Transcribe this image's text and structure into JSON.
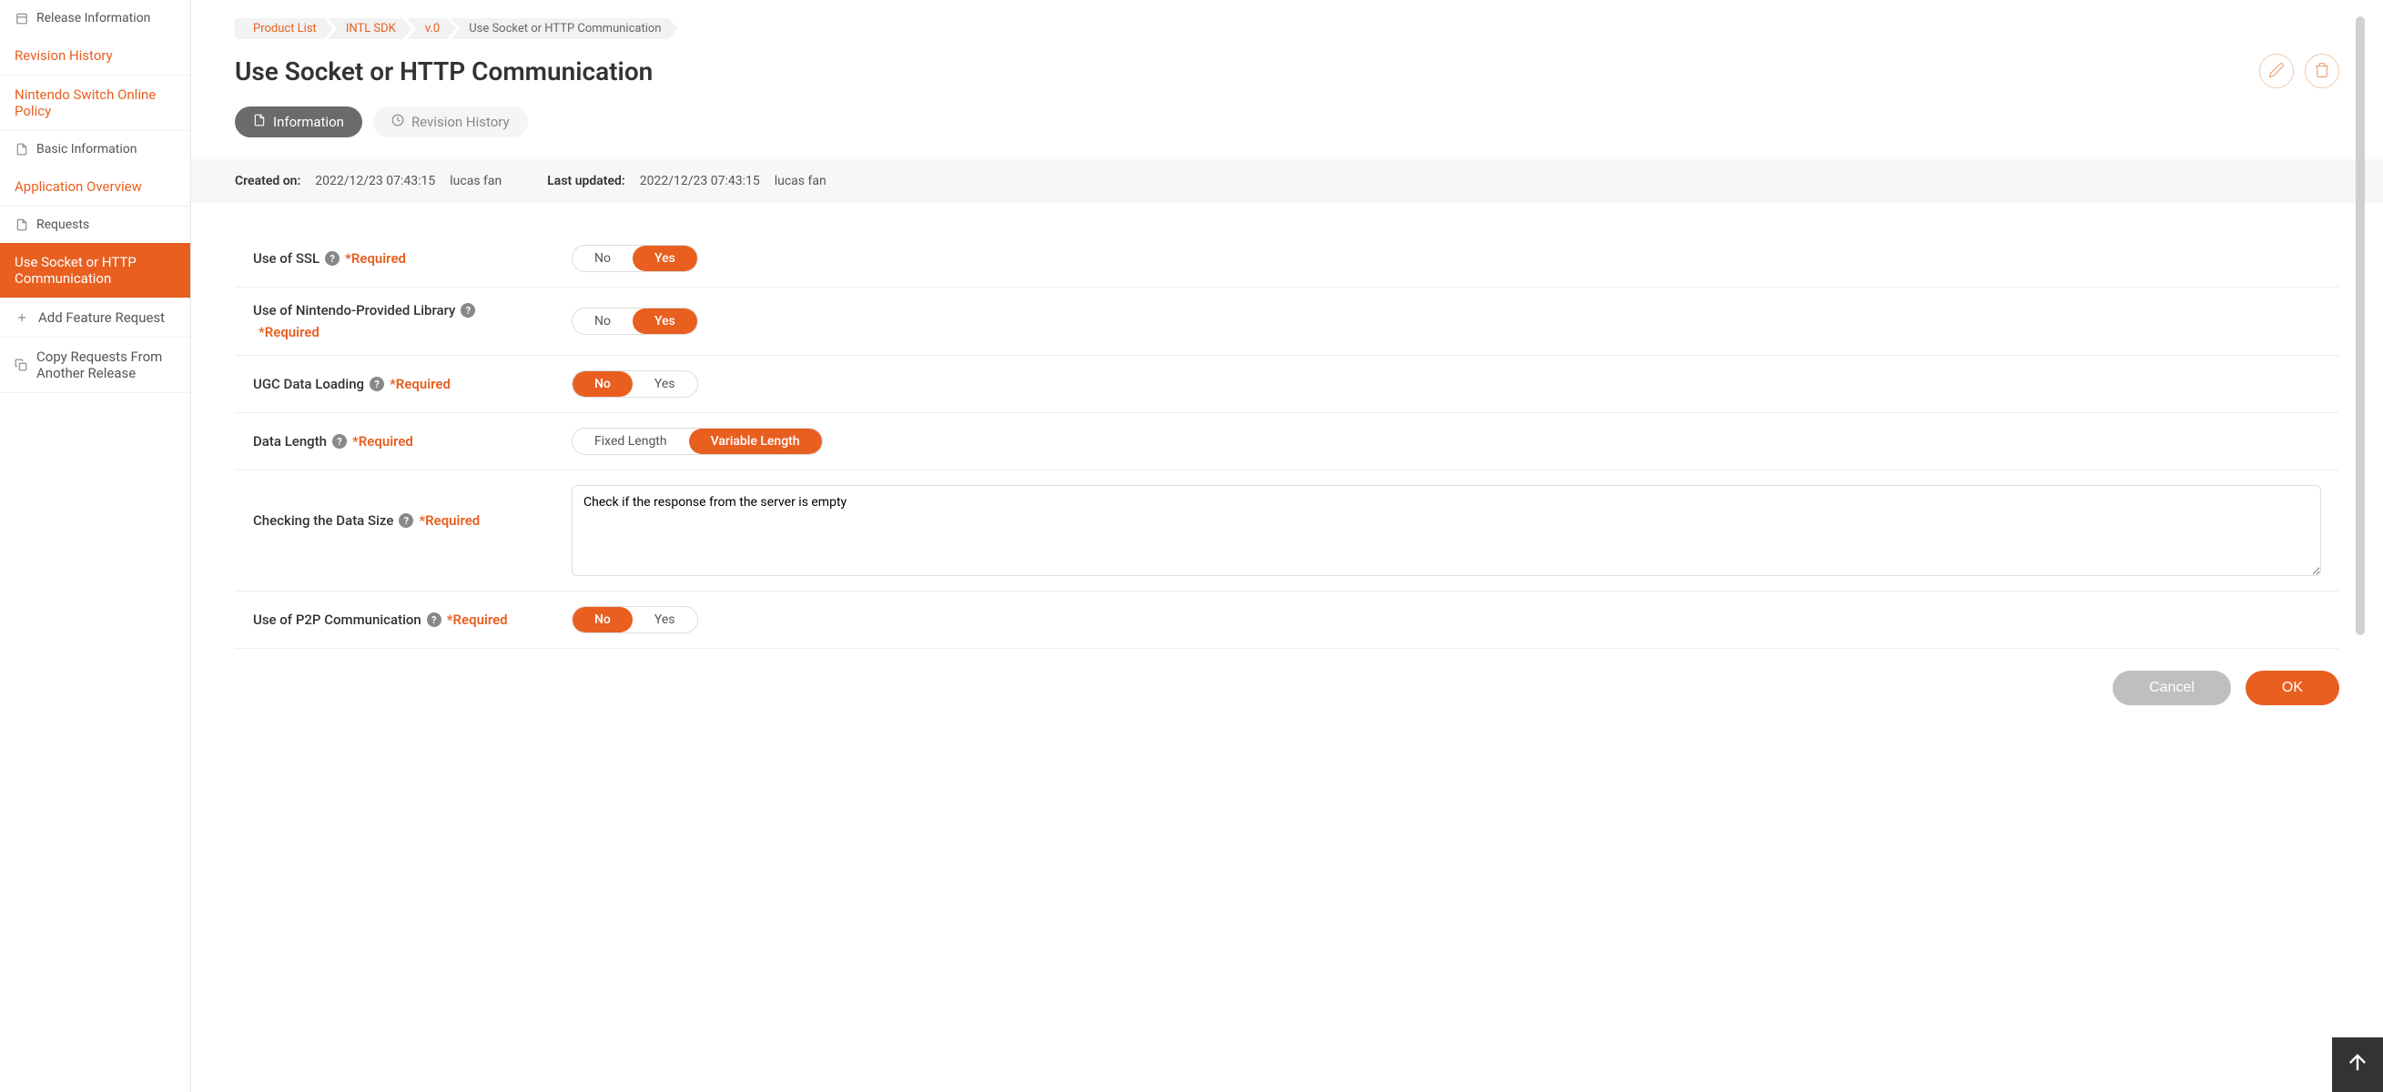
{
  "sidebar": {
    "sections": [
      {
        "header": "Release Information",
        "items": [
          {
            "label": "Revision History"
          },
          {
            "label": "Nintendo Switch Online Policy"
          }
        ]
      },
      {
        "header": "Basic Information",
        "items": [
          {
            "label": "Application Overview"
          }
        ]
      },
      {
        "header": "Requests",
        "items": [
          {
            "label": "Use Socket or HTTP Communication",
            "active": true
          },
          {
            "label": "Add Feature Request",
            "icon": "plus"
          },
          {
            "label": "Copy Requests From Another Release",
            "icon": "copy"
          }
        ]
      }
    ]
  },
  "breadcrumb": [
    {
      "label": "Product List"
    },
    {
      "label": "INTL SDK"
    },
    {
      "label": "v.0"
    },
    {
      "label": "Use Socket or HTTP Communication",
      "current": true
    }
  ],
  "page_title": "Use Socket or HTTP Communication",
  "tabs": {
    "information": "Information",
    "revision_history": "Revision History"
  },
  "meta": {
    "created_label": "Created on:",
    "created_date": "2022/12/23 07:43:15",
    "created_user": "lucas fan",
    "updated_label": "Last updated:",
    "updated_date": "2022/12/23 07:43:15",
    "updated_user": "lucas fan"
  },
  "required_text": "*Required",
  "form": {
    "ssl": {
      "label": "Use of SSL",
      "no": "No",
      "yes": "Yes",
      "selected": "yes"
    },
    "nintendo_lib": {
      "label": "Use of Nintendo-Provided Library",
      "no": "No",
      "yes": "Yes",
      "selected": "yes"
    },
    "ugc": {
      "label": "UGC Data Loading",
      "no": "No",
      "yes": "Yes",
      "selected": "no"
    },
    "data_length": {
      "label": "Data Length",
      "opt1": "Fixed Length",
      "opt2": "Variable Length",
      "selected": "opt2"
    },
    "data_size": {
      "label": "Checking the Data Size",
      "value": "Check if the response from the server is empty"
    },
    "p2p": {
      "label": "Use of P2P Communication",
      "no": "No",
      "yes": "Yes",
      "selected": "no"
    }
  },
  "buttons": {
    "cancel": "Cancel",
    "ok": "OK"
  }
}
